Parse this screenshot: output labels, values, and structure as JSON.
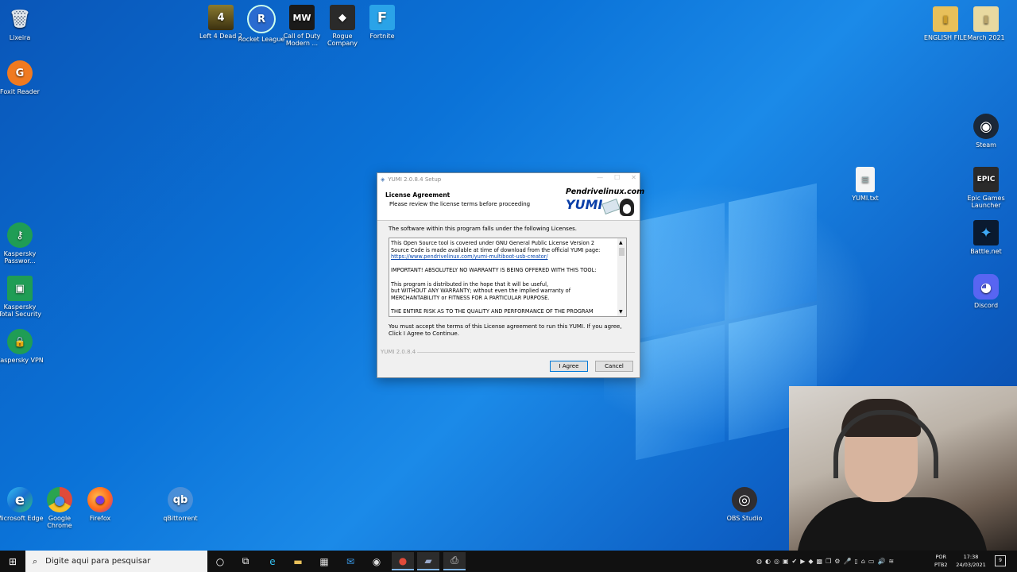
{
  "desktop": {
    "icons": [
      {
        "label": "Lixeira",
        "glyph": "🗑",
        "color": "#cfd8e0"
      },
      {
        "label": "Foxit Reader",
        "glyph": "G",
        "color": "#f07a20"
      },
      {
        "label": "Kaspersky Passwor...",
        "glyph": "⚷",
        "color": "#1f9d55"
      },
      {
        "label": "Kaspersky Total Security",
        "glyph": "▣",
        "color": "#1f9d55"
      },
      {
        "label": "Kaspersky VPN",
        "glyph": "🔒",
        "color": "#1f9d55"
      },
      {
        "label": "Microsoft Edge",
        "glyph": "e",
        "color": "#1f8ed6"
      },
      {
        "label": "Google Chrome",
        "glyph": "●",
        "color": "#e04b3a"
      },
      {
        "label": "Firefox",
        "glyph": "●",
        "color": "#ff7a1a"
      },
      {
        "label": "qBittorrent",
        "glyph": "qb",
        "color": "#4a8fd8"
      },
      {
        "label": "Left 4 Dead 2",
        "glyph": "4",
        "color": "#6b5a20"
      },
      {
        "label": "Rocket League",
        "glyph": "R",
        "color": "#2a6bd0"
      },
      {
        "label": "Call of Duty Modern ...",
        "glyph": "MW",
        "color": "#1a1a1a"
      },
      {
        "label": "Rogue Company",
        "glyph": "◆",
        "color": "#2a2a2a"
      },
      {
        "label": "Fortnite",
        "glyph": "F",
        "color": "#2aa3e8"
      },
      {
        "label": "ENGLISH FILE",
        "glyph": "▮",
        "color": "#e8c05a"
      },
      {
        "label": "March 2021",
        "glyph": "▮",
        "color": "#e8d9a0"
      },
      {
        "label": "Steam",
        "glyph": "◉",
        "color": "#1b2838"
      },
      {
        "label": "YUMI.txt",
        "glyph": "≡",
        "color": "#f4f4f4"
      },
      {
        "label": "Epic Games Launcher",
        "glyph": "EPIC",
        "color": "#2a2a2a"
      },
      {
        "label": "Battle.net",
        "glyph": "✦",
        "color": "#0a1a30"
      },
      {
        "label": "Discord",
        "glyph": "◕",
        "color": "#5865f2"
      },
      {
        "label": "OBS Studio",
        "glyph": "◎",
        "color": "#302e31"
      }
    ]
  },
  "dialog": {
    "title": "YUMI 2.0.8.4 Setup",
    "header_title": "License Agreement",
    "header_subtitle": "Please review the license terms before proceeding",
    "brand": "Pendrivelinux.com",
    "logo": "YUMI",
    "intro": "The software within this program falls under the following Licenses.",
    "license_lines": [
      "This Open Source tool is covered under GNU General Public License Version 2",
      "Source Code is made available at time of download from the official YUMI page:"
    ],
    "license_link": "https://www.pendrivelinux.com/yumi-multiboot-usb-creator/",
    "warranty": "IMPORTANT! ABSOLUTELY NO WARRANTY IS BEING OFFERED WITH THIS TOOL:",
    "distributed": "This program is distributed in the hope that it will be useful,",
    "without": "but WITHOUT ANY WARRANTY; without even the implied warranty of",
    "merch": "MERCHANTABILITY or FITNESS FOR A PARTICULAR PURPOSE.",
    "risk": "THE ENTIRE RISK AS TO THE QUALITY AND PERFORMANCE OF THE PROGRAM",
    "accept_text": "You must accept the terms of this License agreement to run this YUMI. If you agree, Click I Agree to Continue.",
    "version": "YUMI 2.0.8.4",
    "agree_label": "I Agree",
    "cancel_label": "Cancel"
  },
  "taskbar": {
    "search_placeholder": "Digite aqui para pesquisar",
    "lang_top": "POR",
    "lang_bottom": "PTB2",
    "time": "17:38",
    "date": "24/03/2021",
    "notifications": "9"
  }
}
